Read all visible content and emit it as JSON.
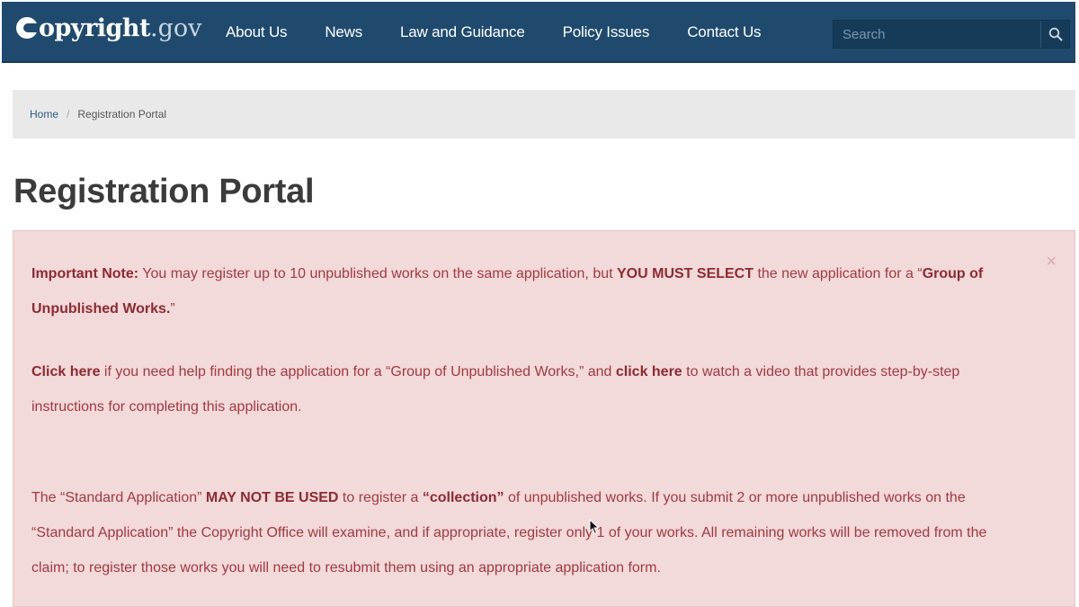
{
  "header": {
    "logo": {
      "word": "opyright",
      "gov": ".gov",
      "icon": "copyright-c-icon"
    },
    "nav": [
      {
        "label": "About Us"
      },
      {
        "label": "News"
      },
      {
        "label": "Law and Guidance"
      },
      {
        "label": "Policy Issues"
      },
      {
        "label": "Contact Us"
      }
    ],
    "search": {
      "placeholder": "Search",
      "value": "",
      "icon": "search-icon"
    },
    "color": "#1f4a6e"
  },
  "breadcrumb": {
    "home": "Home",
    "separator": "/",
    "current": "Registration Portal"
  },
  "page": {
    "title": "Registration Portal"
  },
  "alert": {
    "close": "×",
    "color": "#a33a3f",
    "background": "#f2d9da",
    "p1": {
      "label": "Important Note:",
      "t1": " You may register up to 10 unpublished works on the same application, but ",
      "strong": "YOU MUST SELECT",
      "t2": " the new application for a ",
      "quote_open": "“",
      "name": "Group of Unpublished Works.",
      "quote_close": "”"
    },
    "p2": {
      "link1": "Click here",
      "t1": " if you need help finding the application for a “Group of Unpublished Works,” and ",
      "link2": "click here",
      "t2": " to watch a video that provides step-by-step instructions for completing this application."
    },
    "p3": {
      "t1": "The “Standard Application” ",
      "strong1": "MAY NOT BE USED",
      "t2": " to register a ",
      "strong2": "“collection”",
      "t3": " of unpublished works. If you submit 2 or more unpublished works on the “Standard Application” the Copyright Office will examine, and if appropriate, register only 1 of your works. All remaining works will be removed from the claim; to register those works you will need to resubmit them using an appropriate application form."
    }
  }
}
